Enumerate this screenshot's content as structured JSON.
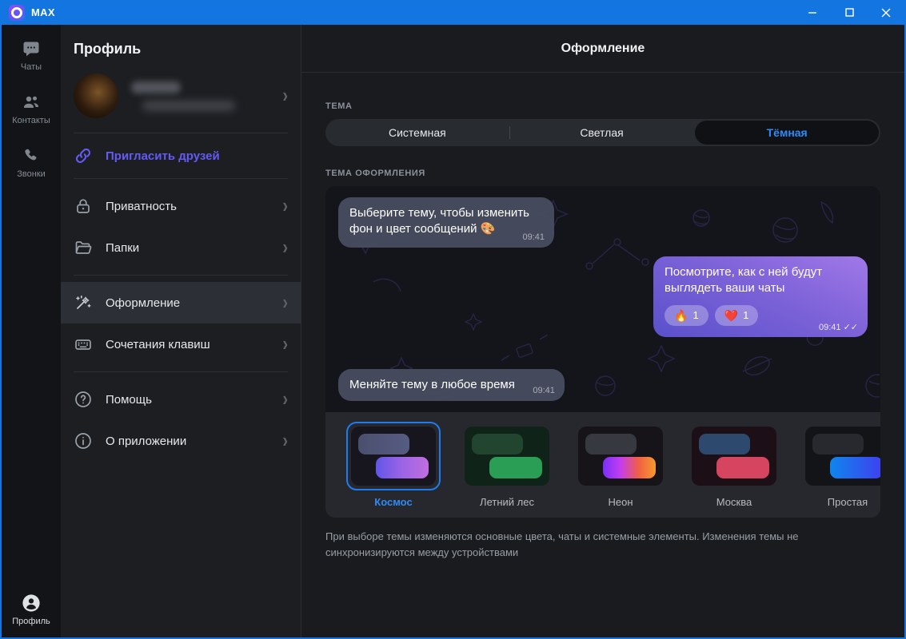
{
  "window": {
    "title": "MAX",
    "controls": {
      "minimize": "minimize",
      "maximize": "maximize",
      "close": "close"
    }
  },
  "colors": {
    "titlebar": "#1375e0",
    "accent_blue": "#2f8af5",
    "invite_violet": "#655af2",
    "selected_row": "#2c2f35"
  },
  "rail": {
    "items": [
      {
        "label": "Чаты"
      },
      {
        "label": "Контакты"
      },
      {
        "label": "Звонки"
      }
    ],
    "bottom": {
      "label": "Профиль"
    }
  },
  "sidebar": {
    "title": "Профиль",
    "invite_label": "Пригласить друзей",
    "menu": [
      {
        "label": "Приватность"
      },
      {
        "label": "Папки"
      },
      {
        "label": "Оформление",
        "selected": true
      },
      {
        "label": "Сочетания клавиш"
      },
      {
        "label": "Помощь"
      },
      {
        "label": "О приложении"
      }
    ]
  },
  "main": {
    "header": "Оформление",
    "theme": {
      "label": "ТЕМА",
      "options": [
        "Системная",
        "Светлая",
        "Тёмная"
      ],
      "selected": "Тёмная"
    },
    "preview": {
      "label": "ТЕМА ОФОРМЛЕНИЯ",
      "messages": [
        {
          "dir": "in",
          "text": "Выберите тему, чтобы изменить фон и цвет сообщений 🎨",
          "time": "09:41"
        },
        {
          "dir": "out",
          "text": "Посмотрите, как с ней будут выглядеть ваши чаты",
          "time": "09:41",
          "ticks": "✓✓",
          "reactions": [
            {
              "emoji": "🔥",
              "count": "1"
            },
            {
              "emoji": "❤️",
              "count": "1"
            }
          ]
        },
        {
          "dir": "in",
          "text": "Меняйте тему в любое время",
          "time": "09:41"
        }
      ],
      "themes": [
        {
          "name": "Космос",
          "selected": true,
          "thumb_bg": "#17161f",
          "in_pill": "linear-gradient(90deg,#4b4f6e,#565b82)",
          "out_pill": "linear-gradient(90deg,#6156e8,#9b64e6,#c06ee0)"
        },
        {
          "name": "Летний лес",
          "thumb_bg": "#0f2318",
          "in_pill": "#21452f",
          "out_pill": "#2a9e55"
        },
        {
          "name": "Неон",
          "thumb_bg": "#161419",
          "in_pill": "#36393f",
          "out_pill": "linear-gradient(90deg,#7b2ff7,#c43df0,#ef5f46,#f59a2c)"
        },
        {
          "name": "Москва",
          "thumb_bg": "#1c1016",
          "in_pill": "#2d4a6e",
          "out_pill": "#d6455f"
        },
        {
          "name": "Простая",
          "thumb_bg": "#131418",
          "in_pill": "#27292e",
          "out_pill": "linear-gradient(90deg,#0f86ec,#3f3ff0)"
        }
      ]
    },
    "footer": "При выборе темы изменяются основные цвета, чаты и системные элементы. Изменения темы не синхронизируются между устройствами"
  }
}
